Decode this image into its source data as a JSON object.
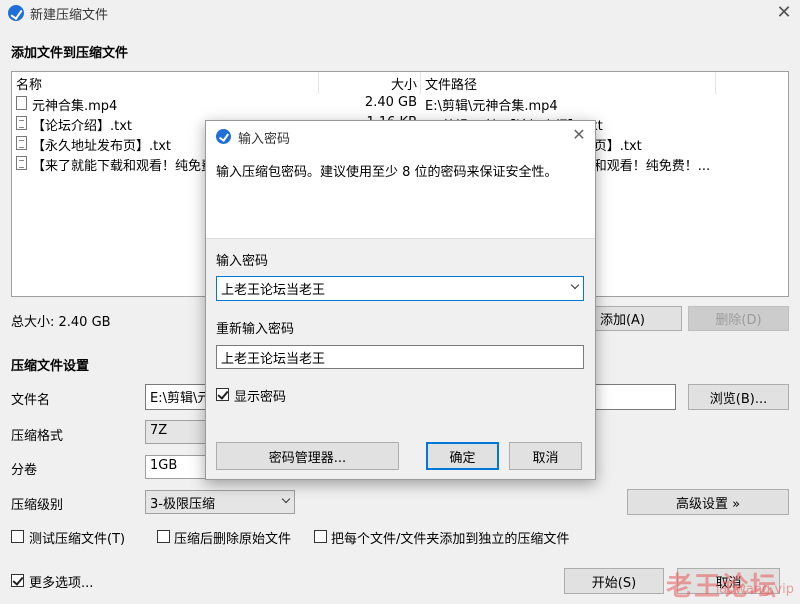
{
  "window": {
    "title": "新建压缩文件"
  },
  "add_section": {
    "heading": "添加文件到压缩文件"
  },
  "file_list": {
    "headers": {
      "name": "名称",
      "size": "大小",
      "path": "文件路径"
    },
    "rows": [
      {
        "name": "元神合集.mp4",
        "size": "2.40 GB",
        "path": "E:\\剪辑\\元神合集.mp4",
        "icon": "video-file-icon"
      },
      {
        "name": "【论坛介绍】.txt",
        "size": "1.16 KB",
        "path": "E:\\剪辑\\元神\\【论坛介绍】.txt",
        "icon": "text-file-icon"
      },
      {
        "name": "【永久地址发布页】.txt",
        "size": "",
        "path": "E:\\剪辑\\元神\\【永久地址发布页】.txt",
        "icon": "text-file-icon"
      },
      {
        "name": "【来了就能下载和观看！纯免费！...",
        "size": "",
        "path": "E:\\剪辑\\元神\\【来了就能下载和观看！纯免费！...",
        "icon": "text-file-icon"
      }
    ]
  },
  "total": {
    "label": "总大小: 2.40 GB"
  },
  "buttons": {
    "add": "添加(A)",
    "delete": "删除(D)",
    "browse": "浏览(B)...",
    "advanced": "高级设置 »",
    "start": "开始(S)",
    "cancel": "取消"
  },
  "settings": {
    "heading": "压缩文件设置",
    "filename_label": "文件名",
    "filename_value": "E:\\剪辑\\元神合集.7z",
    "format_label": "压缩格式",
    "format_value": "7Z",
    "split_label": "分卷",
    "split_value": "1GB",
    "level_label": "压缩级别",
    "level_value": "3-极限压缩"
  },
  "options": {
    "test": "测试压缩文件(T)",
    "delete_after": "压缩后删除原始文件",
    "separate": "把每个文件/文件夹添加到独立的压缩文件",
    "more": "更多选项..."
  },
  "dialog": {
    "title": "输入密码",
    "description": "输入压缩包密码。建议使用至少 8 位的密码来保证安全性。",
    "password_label": "输入密码",
    "password_value": "上老王论坛当老王",
    "confirm_label": "重新输入密码",
    "confirm_value": "上老王论坛当老王",
    "show_password": "显示密码",
    "manager_button": "密码管理器...",
    "ok_button": "确定",
    "cancel_button": "取消"
  },
  "watermark": {
    "text": "老王论坛",
    "sub": "laowang.vip"
  },
  "colors": {
    "accent": "#0078d7",
    "icon_blue": "#1e6fd9",
    "watermark": "#e65c5c"
  }
}
